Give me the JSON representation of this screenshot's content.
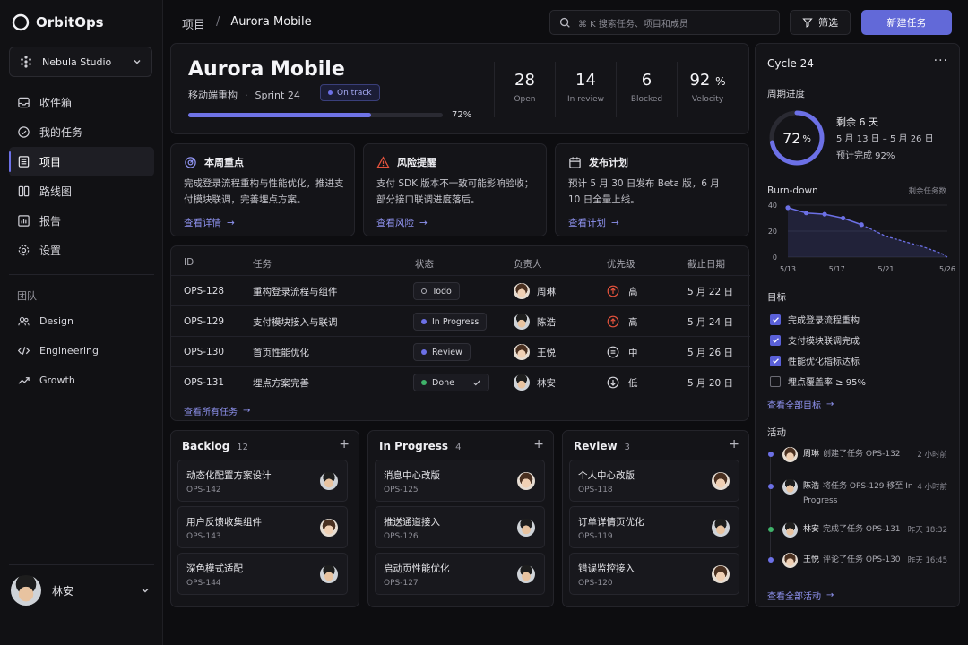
{
  "app": {
    "name": "OrbitOps"
  },
  "workspace": {
    "name": "Nebula Studio"
  },
  "nav": [
    {
      "label": "收件箱",
      "icon": "inbox-icon"
    },
    {
      "label": "我的任务",
      "icon": "check-circle-icon"
    },
    {
      "label": "项目",
      "icon": "list-icon",
      "active": true
    },
    {
      "label": "路线图",
      "icon": "columns-icon"
    },
    {
      "label": "报告",
      "icon": "bar-chart-icon"
    },
    {
      "label": "设置",
      "icon": "gear-icon"
    }
  ],
  "team": {
    "label": "团队",
    "items": [
      {
        "label": "Design",
        "icon": "users-icon"
      },
      {
        "label": "Engineering",
        "icon": "code-icon"
      },
      {
        "label": "Growth",
        "icon": "trend-icon"
      }
    ]
  },
  "user": {
    "name": "林安"
  },
  "breadcrumb": {
    "root": "项目",
    "sep": "/",
    "current": "Aurora Mobile"
  },
  "search": {
    "placeholder": "⌘ K  搜索任务、项目和成员"
  },
  "toolbar": {
    "filter_label": "筛选",
    "new_label": "新建任务"
  },
  "project": {
    "title": "Aurora Mobile",
    "subtitle": "移动端重构",
    "dot": "·",
    "sprint": "Sprint 24",
    "status": "On track",
    "progress": 72,
    "progress_label": "72%",
    "stats": [
      {
        "value": "28",
        "unit": "",
        "label": "Open"
      },
      {
        "value": "14",
        "unit": "",
        "label": "In review"
      },
      {
        "value": "6",
        "unit": "",
        "label": "Blocked"
      },
      {
        "value": "92",
        "unit": "%",
        "label": "Velocity"
      }
    ]
  },
  "info_cards": [
    {
      "title": "本周重点",
      "icon": "target-icon",
      "text": "完成登录流程重构与性能优化，推进支付模块联调，完善埋点方案。",
      "link": "查看详情"
    },
    {
      "title": "风险提醒",
      "icon": "warning-icon",
      "text": "支付 SDK 版本不一致可能影响验收；部分接口联调进度落后。",
      "link": "查看风险"
    },
    {
      "title": "发布计划",
      "icon": "calendar-icon",
      "text": "预计 5 月 30 日发布 Beta 版，6 月 10 日全量上线。",
      "link": "查看计划"
    }
  ],
  "tasks": {
    "headers": [
      "ID",
      "任务",
      "状态",
      "负责人",
      "优先级",
      "截止日期"
    ],
    "rows": [
      {
        "id": "OPS-128",
        "task": "重构登录流程与组件",
        "status": "Todo",
        "status_kind": "todo",
        "owner": "周琳",
        "avatar": "av-c",
        "priority": "高",
        "priority_icon": "arrow-up-circle-icon",
        "due": "5 月 22 日"
      },
      {
        "id": "OPS-129",
        "task": "支付模块接入与联调",
        "status": "In Progress",
        "status_kind": "progress",
        "owner": "陈浩",
        "avatar": "av-b",
        "priority": "高",
        "priority_icon": "arrow-up-circle-icon",
        "due": "5 月 24 日"
      },
      {
        "id": "OPS-130",
        "task": "首页性能优化",
        "status": "Review",
        "status_kind": "review",
        "owner": "王悦",
        "avatar": "av-c",
        "priority": "中",
        "priority_icon": "equals-circle-icon",
        "due": "5 月 26 日"
      },
      {
        "id": "OPS-131",
        "task": "埋点方案完善",
        "status": "Done",
        "status_kind": "done",
        "owner": "林安",
        "avatar": "av-b",
        "priority": "低",
        "priority_icon": "arrow-down-circle-icon",
        "due": "5 月 20 日"
      }
    ],
    "link": "查看所有任务"
  },
  "board": [
    {
      "name": "Backlog",
      "count": "12",
      "cards": [
        {
          "title": "动态化配置方案设计",
          "id": "OPS-142",
          "avatar": "av-b"
        },
        {
          "title": "用户反馈收集组件",
          "id": "OPS-143",
          "avatar": "av-c"
        },
        {
          "title": "深色模式适配",
          "id": "OPS-144",
          "avatar": "av-b"
        }
      ]
    },
    {
      "name": "In Progress",
      "count": "4",
      "cards": [
        {
          "title": "消息中心改版",
          "id": "OPS-125",
          "avatar": "av-c"
        },
        {
          "title": "推送通道接入",
          "id": "OPS-126",
          "avatar": "av-b"
        },
        {
          "title": "启动页性能优化",
          "id": "OPS-127",
          "avatar": "av-b"
        }
      ]
    },
    {
      "name": "Review",
      "count": "3",
      "cards": [
        {
          "title": "个人中心改版",
          "id": "OPS-118",
          "avatar": "av-c"
        },
        {
          "title": "订单详情页优化",
          "id": "OPS-119",
          "avatar": "av-b"
        },
        {
          "title": "错误监控接入",
          "id": "OPS-120",
          "avatar": "av-c"
        }
      ]
    }
  ],
  "cycle": {
    "title": "Cycle 24",
    "more": "···",
    "progress_title": "周期进度",
    "percent": 72,
    "percent_value": "72",
    "percent_unit": "%",
    "remaining": "剩余 6 天",
    "range": "5 月 13 日 – 5 月 26 日",
    "forecast": "预计完成 92%",
    "burndown_title": "Burn-down",
    "burndown_note": "剩余任务数"
  },
  "chart_data": {
    "type": "line",
    "title": "Burn-down",
    "ylabel": "剩余任务数",
    "x_ticks": [
      "5/13",
      "5/17",
      "5/21",
      "5/26"
    ],
    "y_ticks": [
      40,
      20,
      0
    ],
    "ylim": [
      0,
      40
    ],
    "xlim": [
      13,
      26
    ],
    "series": [
      {
        "style": "solid",
        "x": [
          13,
          14.5,
          16,
          17.5,
          19
        ],
        "y": [
          38,
          34,
          33,
          30,
          25
        ]
      },
      {
        "style": "dashed",
        "x": [
          19,
          21,
          22.5,
          24,
          25.5,
          26
        ],
        "y": [
          25,
          16,
          12,
          8,
          3,
          0
        ]
      }
    ],
    "color": "#6c70e6"
  },
  "goals": {
    "title": "目标",
    "items": [
      {
        "label": "完成登录流程重构",
        "checked": true
      },
      {
        "label": "支付模块联调完成",
        "checked": true
      },
      {
        "label": "性能优化指标达标",
        "checked": true
      },
      {
        "label": "埋点覆盖率 ≥ 95%",
        "checked": false
      }
    ],
    "link": "查看全部目标"
  },
  "activity": {
    "title": "活动",
    "items": [
      {
        "who": "周琳",
        "what": "创建了任务 OPS-132",
        "time": "2 小时前",
        "avatar": "av-c",
        "dot": "#6c70e6"
      },
      {
        "who": "陈浩",
        "what": "将任务 OPS-129 移至 In Progress",
        "time": "4 小时前",
        "avatar": "av-b",
        "dot": "#6c70e6"
      },
      {
        "who": "林安",
        "what": "完成了任务 OPS-131",
        "time": "昨天 18:32",
        "avatar": "av-b",
        "dot": "#3fb36a"
      },
      {
        "who": "王悦",
        "what": "评论了任务 OPS-130",
        "time": "昨天 16:45",
        "avatar": "av-c",
        "dot": "#6c70e6"
      }
    ],
    "link": "查看全部活动"
  },
  "colors": {
    "accent": "#6269d8",
    "todo": "#9a9aa3",
    "progress": "#6c70e6",
    "review": "#6c70e6",
    "done": "#3fb36a",
    "priority_high": "#e5533d"
  }
}
